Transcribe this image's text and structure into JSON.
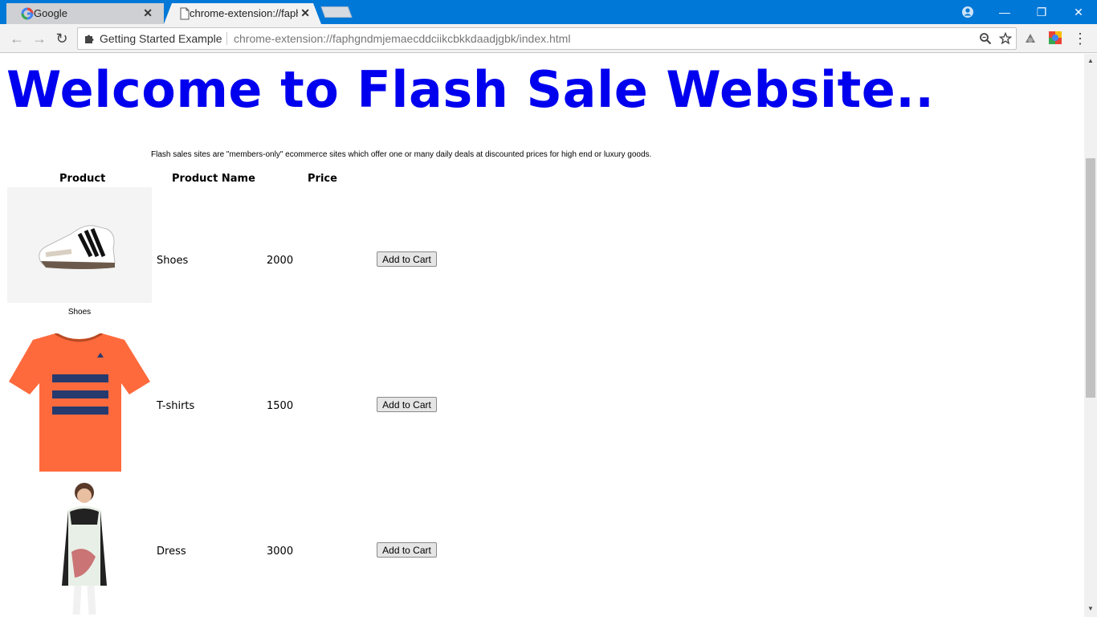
{
  "browser": {
    "tabs": [
      {
        "title": "Google",
        "close": "✕"
      },
      {
        "title": "chrome-extension://faphgndmjemaecddciikcbkkdaadjgbk/index.html",
        "close": "✕"
      }
    ],
    "window_controls": {
      "minimize": "—",
      "restore": "❐",
      "close": "✕"
    },
    "nav": {
      "back": "←",
      "forward": "→",
      "reload": "↻"
    },
    "omnibox": {
      "site_label": "Getting Started Example",
      "url": "chrome-extension://faphgndmjemaecddciikcbkkdaadjgbk/index.html"
    },
    "menu": "⋮",
    "accent": "#0078d7"
  },
  "page": {
    "heading": "Welcome to Flash Sale Website..",
    "heading_color": "#0000ee",
    "intro": "Flash sales sites are \"members-only\" ecommerce sites which offer one or many daily deals at discounted prices for high end or luxury goods.",
    "table": {
      "headers": [
        "Product",
        "Product Name",
        "Price"
      ],
      "rows": [
        {
          "caption": "Shoes",
          "name": "Shoes",
          "price": "2000",
          "button": "Add to Cart"
        },
        {
          "caption": "",
          "name": "T-shirts",
          "price": "1500",
          "button": "Add to Cart"
        },
        {
          "caption": "",
          "name": "Dress",
          "price": "3000",
          "button": "Add to Cart"
        }
      ]
    }
  },
  "scrollbar": {
    "up": "▲",
    "down": "▼"
  }
}
